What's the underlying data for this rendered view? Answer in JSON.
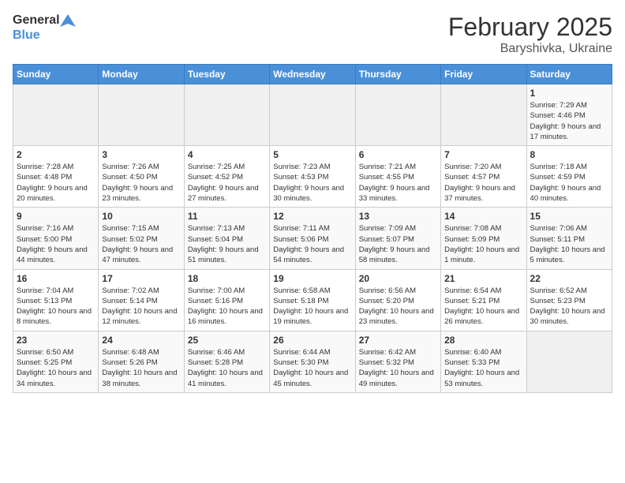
{
  "header": {
    "logo_general": "General",
    "logo_blue": "Blue",
    "title": "February 2025",
    "location": "Baryshivka, Ukraine"
  },
  "days_of_week": [
    "Sunday",
    "Monday",
    "Tuesday",
    "Wednesday",
    "Thursday",
    "Friday",
    "Saturday"
  ],
  "weeks": [
    [
      {
        "day": "",
        "info": ""
      },
      {
        "day": "",
        "info": ""
      },
      {
        "day": "",
        "info": ""
      },
      {
        "day": "",
        "info": ""
      },
      {
        "day": "",
        "info": ""
      },
      {
        "day": "",
        "info": ""
      },
      {
        "day": "1",
        "info": "Sunrise: 7:29 AM\nSunset: 4:46 PM\nDaylight: 9 hours and 17 minutes."
      }
    ],
    [
      {
        "day": "2",
        "info": "Sunrise: 7:28 AM\nSunset: 4:48 PM\nDaylight: 9 hours and 20 minutes."
      },
      {
        "day": "3",
        "info": "Sunrise: 7:26 AM\nSunset: 4:50 PM\nDaylight: 9 hours and 23 minutes."
      },
      {
        "day": "4",
        "info": "Sunrise: 7:25 AM\nSunset: 4:52 PM\nDaylight: 9 hours and 27 minutes."
      },
      {
        "day": "5",
        "info": "Sunrise: 7:23 AM\nSunset: 4:53 PM\nDaylight: 9 hours and 30 minutes."
      },
      {
        "day": "6",
        "info": "Sunrise: 7:21 AM\nSunset: 4:55 PM\nDaylight: 9 hours and 33 minutes."
      },
      {
        "day": "7",
        "info": "Sunrise: 7:20 AM\nSunset: 4:57 PM\nDaylight: 9 hours and 37 minutes."
      },
      {
        "day": "8",
        "info": "Sunrise: 7:18 AM\nSunset: 4:59 PM\nDaylight: 9 hours and 40 minutes."
      }
    ],
    [
      {
        "day": "9",
        "info": "Sunrise: 7:16 AM\nSunset: 5:00 PM\nDaylight: 9 hours and 44 minutes."
      },
      {
        "day": "10",
        "info": "Sunrise: 7:15 AM\nSunset: 5:02 PM\nDaylight: 9 hours and 47 minutes."
      },
      {
        "day": "11",
        "info": "Sunrise: 7:13 AM\nSunset: 5:04 PM\nDaylight: 9 hours and 51 minutes."
      },
      {
        "day": "12",
        "info": "Sunrise: 7:11 AM\nSunset: 5:06 PM\nDaylight: 9 hours and 54 minutes."
      },
      {
        "day": "13",
        "info": "Sunrise: 7:09 AM\nSunset: 5:07 PM\nDaylight: 9 hours and 58 minutes."
      },
      {
        "day": "14",
        "info": "Sunrise: 7:08 AM\nSunset: 5:09 PM\nDaylight: 10 hours and 1 minute."
      },
      {
        "day": "15",
        "info": "Sunrise: 7:06 AM\nSunset: 5:11 PM\nDaylight: 10 hours and 5 minutes."
      }
    ],
    [
      {
        "day": "16",
        "info": "Sunrise: 7:04 AM\nSunset: 5:13 PM\nDaylight: 10 hours and 8 minutes."
      },
      {
        "day": "17",
        "info": "Sunrise: 7:02 AM\nSunset: 5:14 PM\nDaylight: 10 hours and 12 minutes."
      },
      {
        "day": "18",
        "info": "Sunrise: 7:00 AM\nSunset: 5:16 PM\nDaylight: 10 hours and 16 minutes."
      },
      {
        "day": "19",
        "info": "Sunrise: 6:58 AM\nSunset: 5:18 PM\nDaylight: 10 hours and 19 minutes."
      },
      {
        "day": "20",
        "info": "Sunrise: 6:56 AM\nSunset: 5:20 PM\nDaylight: 10 hours and 23 minutes."
      },
      {
        "day": "21",
        "info": "Sunrise: 6:54 AM\nSunset: 5:21 PM\nDaylight: 10 hours and 26 minutes."
      },
      {
        "day": "22",
        "info": "Sunrise: 6:52 AM\nSunset: 5:23 PM\nDaylight: 10 hours and 30 minutes."
      }
    ],
    [
      {
        "day": "23",
        "info": "Sunrise: 6:50 AM\nSunset: 5:25 PM\nDaylight: 10 hours and 34 minutes."
      },
      {
        "day": "24",
        "info": "Sunrise: 6:48 AM\nSunset: 5:26 PM\nDaylight: 10 hours and 38 minutes."
      },
      {
        "day": "25",
        "info": "Sunrise: 6:46 AM\nSunset: 5:28 PM\nDaylight: 10 hours and 41 minutes."
      },
      {
        "day": "26",
        "info": "Sunrise: 6:44 AM\nSunset: 5:30 PM\nDaylight: 10 hours and 45 minutes."
      },
      {
        "day": "27",
        "info": "Sunrise: 6:42 AM\nSunset: 5:32 PM\nDaylight: 10 hours and 49 minutes."
      },
      {
        "day": "28",
        "info": "Sunrise: 6:40 AM\nSunset: 5:33 PM\nDaylight: 10 hours and 53 minutes."
      },
      {
        "day": "",
        "info": ""
      }
    ]
  ]
}
